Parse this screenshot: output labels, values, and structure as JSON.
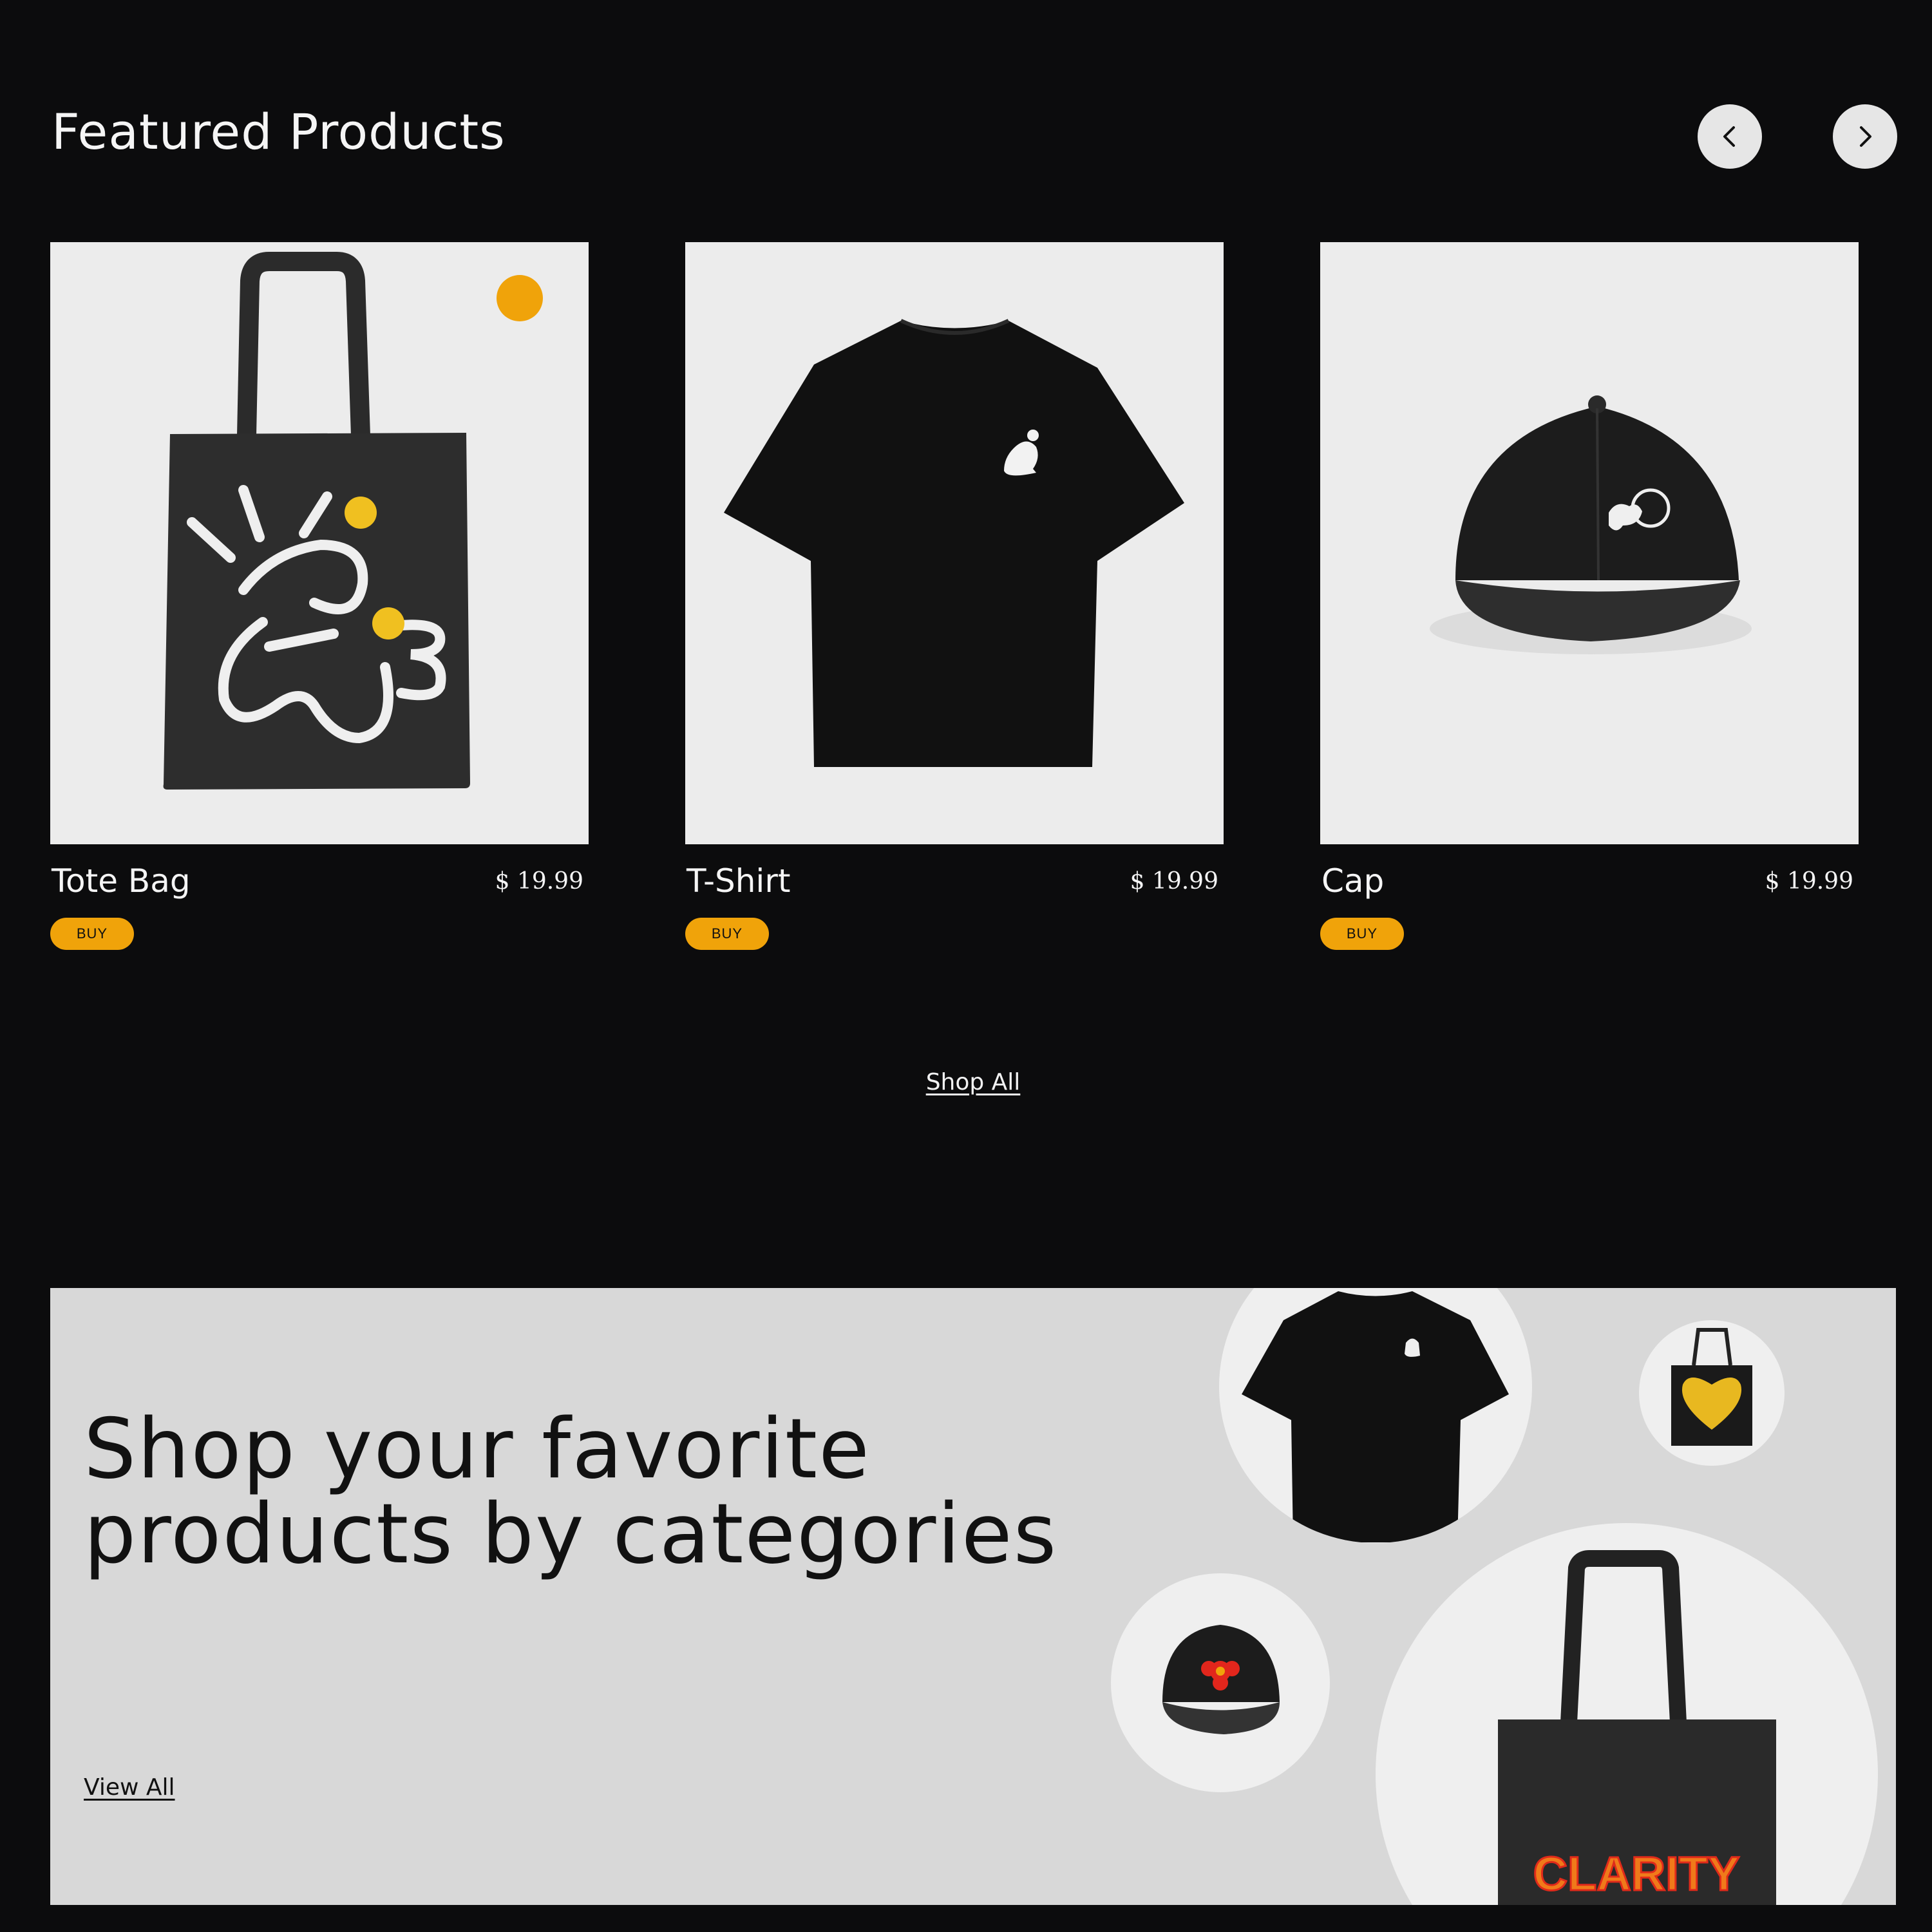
{
  "featured": {
    "title": "Featured Products",
    "prev_label": "previous",
    "next_label": "next"
  },
  "products": [
    {
      "name": "Tote Bag",
      "price": "$ 19.99",
      "buy": "BUY"
    },
    {
      "name": "T-Shirt",
      "price": "$ 19.99",
      "buy": "BUY"
    },
    {
      "name": "Cap",
      "price": "$ 19.99",
      "buy": "BUY"
    }
  ],
  "shop_all": "Shop All",
  "categories": {
    "title_line1": "Shop your favorite",
    "title_line2": "products by categories",
    "view_all": "View All",
    "tote_print": "CLARITY"
  },
  "colors": {
    "background": "#0c0c0d",
    "accent": "#f0a30a",
    "card_bg": "#ececec",
    "banner_bg": "#d8d8d8"
  },
  "icons": [
    "chevron-left-icon",
    "chevron-right-icon"
  ]
}
